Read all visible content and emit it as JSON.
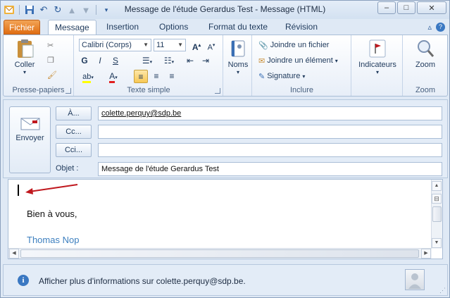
{
  "window": {
    "title": "Message de l'étude Gerardus Test  -  Message (HTML)",
    "controls": {
      "minimize": "–",
      "maximize": "□",
      "close": "✕"
    }
  },
  "tabs": [
    {
      "label": "Fichier"
    },
    {
      "label": "Message"
    },
    {
      "label": "Insertion"
    },
    {
      "label": "Options"
    },
    {
      "label": "Format du texte"
    },
    {
      "label": "Révision"
    }
  ],
  "ribbon": {
    "clipboard": {
      "paste_label": "Coller",
      "group_label": "Presse-papiers"
    },
    "text": {
      "font": "Calibri (Corps)",
      "size": "11",
      "bold": "G",
      "italic": "I",
      "underline": "S",
      "group_label": "Texte simple"
    },
    "names": {
      "label": "Noms"
    },
    "include": {
      "attach_file": "Joindre un fichier",
      "attach_item": "Joindre un élément",
      "signature": "Signature",
      "group_label": "Inclure"
    },
    "indicators": {
      "label": "Indicateurs"
    },
    "zoom": {
      "button": "Zoom",
      "group_label": "Zoom"
    }
  },
  "header": {
    "send_label": "Envoyer",
    "to_button": "À...",
    "cc_button": "Cc...",
    "bcc_button": "Cci...",
    "subject_label": "Objet :",
    "to_value": "colette.perquy@sdp.be",
    "cc_value": "",
    "bcc_value": "",
    "subject_value": "Message de l'étude Gerardus Test"
  },
  "body": {
    "closing": "Bien à vous,",
    "signature": "Thomas Nop"
  },
  "infobar": {
    "text": "Afficher plus d'informations sur colette.perquy@sdp.be."
  },
  "colors": {
    "file_tab": "#e06d12",
    "signature": "#3d7fbf",
    "annotation_arrow": "#c0181e"
  }
}
